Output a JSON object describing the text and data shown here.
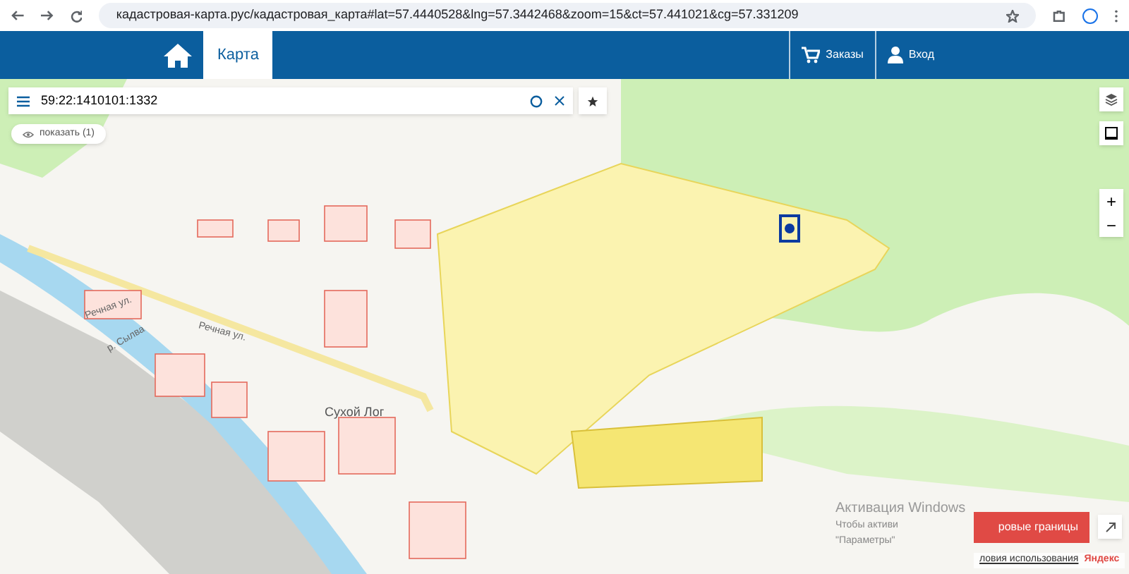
{
  "browser": {
    "url": "кадастровая-карта.рус/кадастровая_карта#lat=57.4440528&lng=57.3442468&zoom=15&ct=57.441021&cg=57.331209"
  },
  "navbar": {
    "tabs": [
      {
        "label": "Карта",
        "selected": true
      }
    ],
    "actions": [
      {
        "label": "Заказы",
        "kind": "cart"
      },
      {
        "label": "Вход",
        "kind": "user"
      }
    ]
  },
  "search": {
    "value": "59:22:1410101:1332"
  },
  "show_button": {
    "label": "показать (1)"
  },
  "map_labels": [
    {
      "text": "Речная ул.",
      "kind": "street"
    },
    {
      "text": "Речная ул.",
      "kind": "street"
    },
    {
      "text": "Сухой Лог",
      "kind": "place"
    },
    {
      "text": "р. Сылва",
      "kind": "river"
    }
  ],
  "zoom": {
    "in": "+",
    "out": "−"
  },
  "overlay": {
    "title": "Активация Windows",
    "lines": [
      "Чтобы активи",
      "\"Параметры\""
    ]
  },
  "red_button": {
    "label": "ровые границы"
  },
  "footer": {
    "link": "ловия использования",
    "brand": "Яндекс"
  }
}
